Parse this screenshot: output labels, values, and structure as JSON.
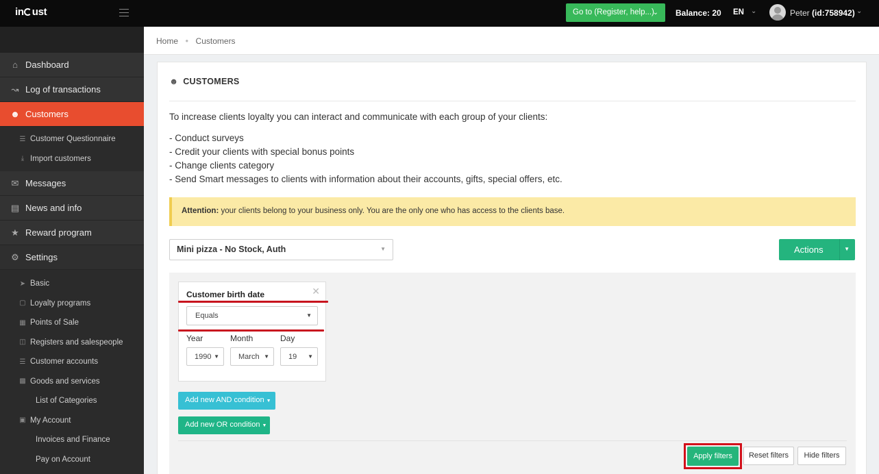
{
  "topbar": {
    "logo_pre": "in",
    "logo_post": "ust",
    "goto_label": "Go to (Register, help...)",
    "balance_label": "Balance:",
    "balance_value": "20",
    "lang": "EN",
    "user_name": "Peter",
    "user_id": "(id:758942)"
  },
  "sidebar": {
    "items": [
      {
        "label": "Dashboard",
        "icon": "home-icon"
      },
      {
        "label": "Log of transactions",
        "icon": "trend-icon"
      },
      {
        "label": "Customers",
        "icon": "users-icon"
      },
      {
        "label": "Customer Questionnaire",
        "icon": "list-icon"
      },
      {
        "label": "Import customers",
        "icon": "download-icon"
      },
      {
        "label": "Messages",
        "icon": "message-icon"
      },
      {
        "label": "News and info",
        "icon": "newspaper-icon"
      },
      {
        "label": "Reward program",
        "icon": "star-icon"
      },
      {
        "label": "Settings",
        "icon": "gear-icon"
      },
      {
        "label": "Basic",
        "icon": "rocket-icon"
      },
      {
        "label": "Loyalty programs",
        "icon": "file-icon"
      },
      {
        "label": "Points of Sale",
        "icon": "building-icon"
      },
      {
        "label": "Registers and salespeople",
        "icon": "cart-icon"
      },
      {
        "label": "Customer accounts",
        "icon": "list-icon"
      },
      {
        "label": "Goods and services",
        "icon": "gift-icon"
      },
      {
        "label": "List of Categories",
        "icon": ""
      },
      {
        "label": "My Account",
        "icon": "money-icon"
      },
      {
        "label": "Invoices and Finance",
        "icon": ""
      },
      {
        "label": "Pay on Account",
        "icon": ""
      }
    ]
  },
  "breadcrumb": {
    "home": "Home",
    "current": "Customers"
  },
  "panel": {
    "title": "CUSTOMERS",
    "intro": "To increase clients loyalty you can interact and communicate with each group of your clients:",
    "bullets": [
      "- Conduct surveys",
      "- Credit your clients with special bonus points",
      "- Change clients category",
      "- Send Smart messages to clients with information about their accounts, gifts, special offers, etc."
    ],
    "alert_strong": "Attention:",
    "alert_text": " your clients belong to your business only. You are the only one who has access to the clients base.",
    "program_select": "Mini pizza - No Stock, Auth",
    "actions_label": "Actions"
  },
  "filter": {
    "condition_title": "Customer birth date",
    "operator": "Equals",
    "year_label": "Year",
    "month_label": "Month",
    "day_label": "Day",
    "year_value": "1990",
    "month_value": "March",
    "day_value": "19",
    "add_and": "Add new AND condition",
    "add_or": "Add new OR condition",
    "apply": "Apply filters",
    "reset": "Reset filters",
    "hide": "Hide filters"
  },
  "colors": {
    "accent": "#e84d2f",
    "green": "#24b47e",
    "teal": "#37c0d4",
    "highlight_red": "#d2101a",
    "alert_bg": "#fbeaa6"
  }
}
